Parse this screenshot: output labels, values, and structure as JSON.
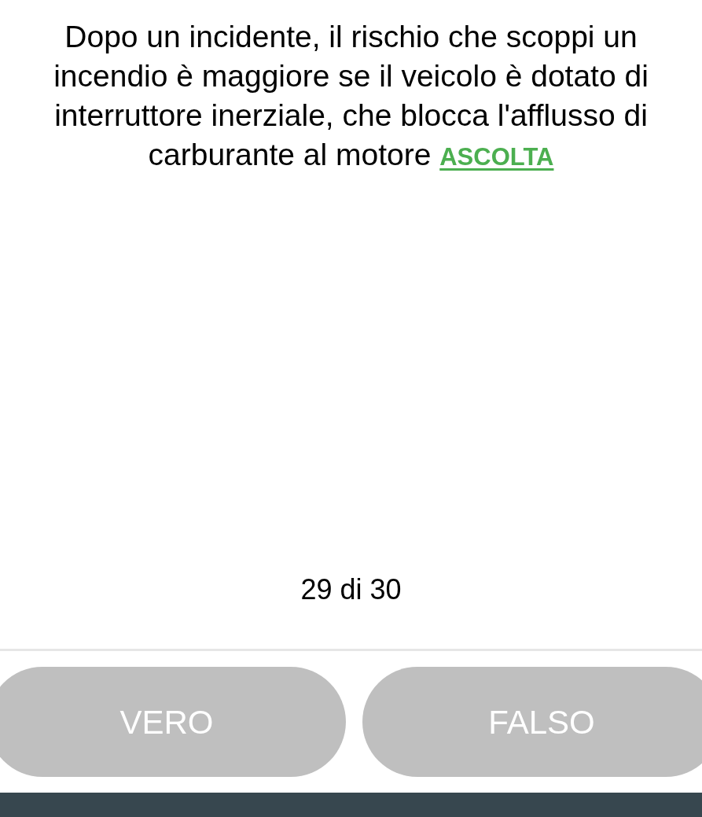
{
  "question": {
    "text": "Dopo un incidente, il rischio che scoppi un incendio è maggiore se il veicolo è dotato di interruttore inerziale, che blocca l'afflusso di carburante al motore",
    "listen_link": "ASCOLTA"
  },
  "progress": "29 di 30",
  "answers": [
    {
      "label": "VERO"
    },
    {
      "label": "FALSO"
    }
  ]
}
